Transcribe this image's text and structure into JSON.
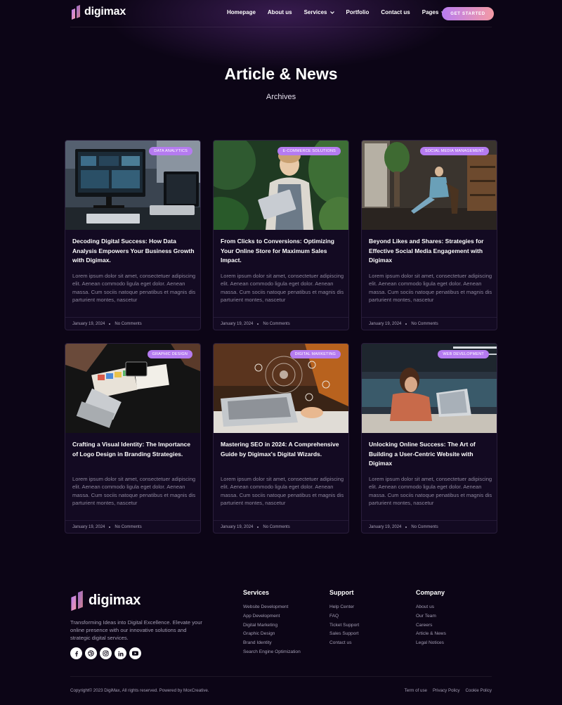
{
  "brand": {
    "name": "digimax",
    "gradient_start": "#b57bf0",
    "gradient_end": "#f49aa4"
  },
  "nav": {
    "items": [
      "Homepage",
      "About us",
      "Services",
      "Portfolio",
      "Contact us",
      "Pages"
    ],
    "cta": "GET STARTED"
  },
  "hero": {
    "title": "Article & News",
    "subtitle": "Archives"
  },
  "posts": [
    {
      "category": "DATA ANALYTICS",
      "title": "Decoding Digital Success: How Data Analysis Empowers Your Business Growth with Digimax.",
      "excerpt": "Lorem ipsum dolor sit amet, consectetuer adipiscing elit. Aenean commodo ligula eget dolor. Aenean massa. Cum sociis natoque penatibus et magnis dis parturient montes, nascetur",
      "date": "January 19, 2024",
      "comments": "No Comments"
    },
    {
      "category": "E-COMMERCE SOLUTIONS",
      "title": "From Clicks to Conversions: Optimizing Your Online Store for Maximum Sales Impact.",
      "excerpt": "Lorem ipsum dolor sit amet, consectetuer adipiscing elit. Aenean commodo ligula eget dolor. Aenean massa. Cum sociis natoque penatibus et magnis dis parturient montes, nascetur",
      "date": "January 19, 2024",
      "comments": "No Comments"
    },
    {
      "category": "SOCIAL MEDIA MANAGEMENT",
      "title": "Beyond Likes and Shares: Strategies for Effective Social Media Engagement with Digimax",
      "excerpt": "Lorem ipsum dolor sit amet, consectetuer adipiscing elit. Aenean commodo ligula eget dolor. Aenean massa. Cum sociis natoque penatibus et magnis dis parturient montes, nascetur",
      "date": "January 19, 2024",
      "comments": "No Comments"
    },
    {
      "category": "GRAPHIC DESIGN",
      "title": "Crafting a Visual Identity: The Importance of Logo Design in Branding Strategies.",
      "excerpt": "Lorem ipsum dolor sit amet, consectetuer adipiscing elit. Aenean commodo ligula eget dolor. Aenean massa. Cum sociis natoque penatibus et magnis dis parturient montes, nascetur",
      "date": "January 19, 2024",
      "comments": "No Comments"
    },
    {
      "category": "DIGITAL MARKETING",
      "title": "Mastering SEO in 2024: A Comprehensive Guide by Digimax's Digital Wizards.",
      "excerpt": "Lorem ipsum dolor sit amet, consectetuer adipiscing elit. Aenean commodo ligula eget dolor. Aenean massa. Cum sociis natoque penatibus et magnis dis parturient montes, nascetur",
      "date": "January 19, 2024",
      "comments": "No Comments"
    },
    {
      "category": "WEB DEVELOPMENT",
      "title": "Unlocking Online Success: The Art of Building a User-Centric Website with Digimax",
      "excerpt": "Lorem ipsum dolor sit amet, consectetuer adipiscing elit. Aenean commodo ligula eget dolor. Aenean massa. Cum sociis natoque penatibus et magnis dis parturient montes, nascetur",
      "date": "January 19, 2024",
      "comments": "No Comments"
    }
  ],
  "footer": {
    "description": "Transforming Ideas into Digital Excellence. Elevate your online presence with our innovative solutions and strategic digital services.",
    "socials": [
      "facebook-icon",
      "dribbble-icon",
      "instagram-icon",
      "linkedin-icon",
      "youtube-icon"
    ],
    "services": {
      "title": "Services",
      "links": [
        "Website Development",
        "App Development",
        "Digital Marketing",
        "Graphic Design",
        "Brand Identity",
        "Search Engine Optimization"
      ]
    },
    "support": {
      "title": "Support",
      "links": [
        "Help Center",
        "FAQ",
        "Ticket Support",
        "Sales Support",
        "Contact us"
      ]
    },
    "company": {
      "title": "Company",
      "links": [
        "About us",
        "Our Team",
        "Careers",
        "Article & News",
        "Legal Notices"
      ]
    },
    "copyright": "Copyright© 2023 DigiMax, All rights reserved. Powered by MoxCreative.",
    "legal": [
      "Term of use",
      "Privacy Policy",
      "Cookie Policy"
    ]
  }
}
